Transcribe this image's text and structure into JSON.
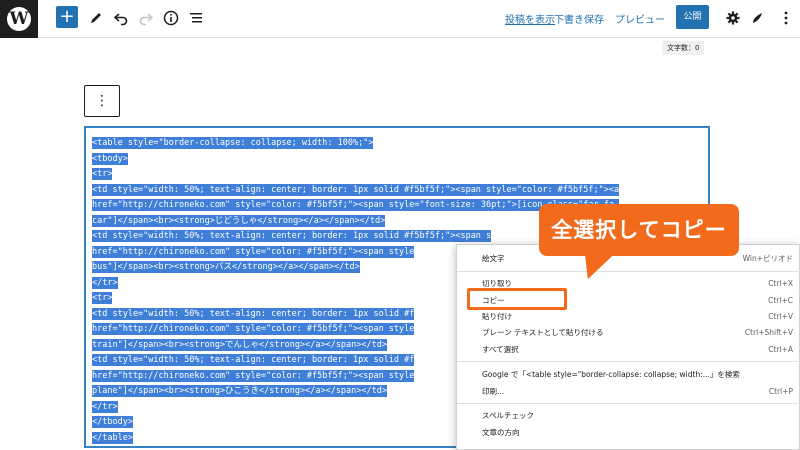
{
  "toolbar": {
    "logo_glyph": "W",
    "add_glyph": "+",
    "view_post": "投稿を表示",
    "save_draft": "下書き保存",
    "preview": "プレビュー",
    "publish": "公開",
    "icons": [
      "wordpress-logo",
      "add-block-icon",
      "tools-pen-icon",
      "undo-icon",
      "redo-icon",
      "info-icon",
      "list-view-icon",
      "settings-gear-icon",
      "styles-icon",
      "more-options-icon"
    ]
  },
  "editor": {
    "char_count": "文字数：0",
    "block_options_glyph": "⋮",
    "code_lines": [
      "<table style=\"border-collapse: collapse; width: 100%;\">",
      "<tbody>",
      "<tr>",
      "<td style=\"width: 50%; text-align: center; border: 1px solid #f5bf5f;\"><span style=\"color: #f5bf5f;\"><a",
      "href=\"http://chironeko.com\" style=\"color: #f5bf5f;\"><span style=\"font-size: 36pt;\">[icon class=\"far fa-",
      "car\"]</span><br><strong>じどうしゃ</strong></a></span></td>",
      "<td style=\"width: 50%; text-align: center; border: 1px solid #f5bf5f;\"><span s",
      "href=\"http://chironeko.com\" style=\"color: #f5bf5f;\"><span style",
      "bus\"]</span><br><strong>バス</strong></a></span></td>",
      "</tr>",
      "<tr>",
      "<td style=\"width: 50%; text-align: center; border: 1px solid #f",
      "href=\"http://chironeko.com\" style=\"color: #f5bf5f;\"><span style",
      "train\"]</span><br><strong>でんしゃ</strong></a></span></td>",
      "<td style=\"width: 50%; text-align: center; border: 1px solid #f",
      "href=\"http://chironeko.com\" style=\"color: #f5bf5f;\"><span style",
      "plane\"]</span><br><strong>ひこうき</strong></a></span></td>",
      "</tr>",
      "</tbody>",
      "</table>"
    ]
  },
  "context_menu": {
    "items": [
      {
        "label": "絵文字",
        "shortcut": "Win+ピリオド"
      },
      {
        "label": "切り取り",
        "shortcut": "Ctrl+X"
      },
      {
        "label": "コピー",
        "shortcut": "Ctrl+C"
      },
      {
        "label": "貼り付け",
        "shortcut": "Ctrl+V"
      },
      {
        "label": "プレーン テキストとして貼り付ける",
        "shortcut": "Ctrl+Shift+V"
      },
      {
        "label": "すべて選択",
        "shortcut": "Ctrl+A"
      },
      {
        "label": "Google で「<table style=\"border-collapse: collapse; width:...」を検索",
        "shortcut": ""
      },
      {
        "label": "印刷...",
        "shortcut": "Ctrl+P"
      },
      {
        "label": "スペルチェック",
        "shortcut": ""
      },
      {
        "label": "文章の方向",
        "shortcut": ""
      }
    ]
  },
  "annotation": {
    "callout_text": "全選択してコピー",
    "accent_color": "#f26b1d"
  },
  "colors": {
    "wp_blue": "#2271b1",
    "selection": "#3f7fd8",
    "dark": "#1e1e1e"
  }
}
